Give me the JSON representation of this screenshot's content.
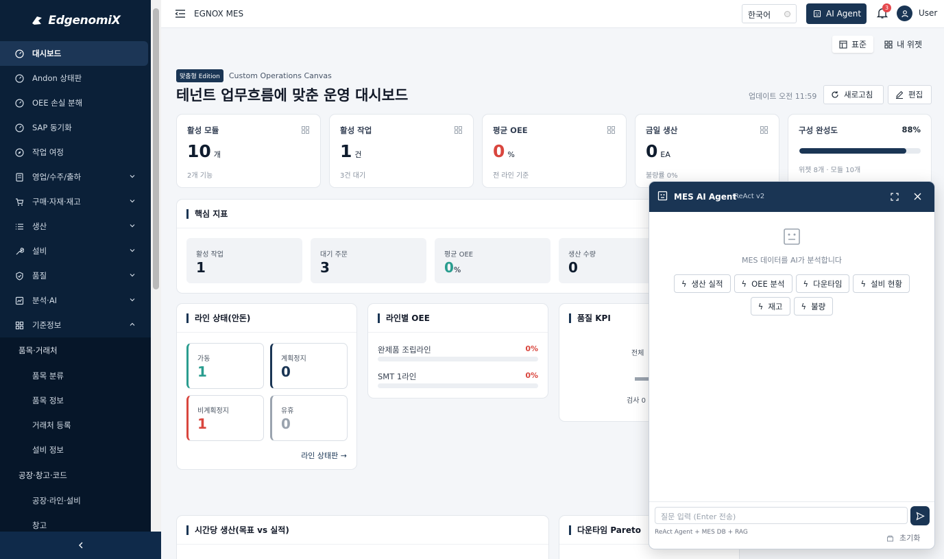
{
  "brand": {
    "name": "EdgenomiX"
  },
  "sidebar": {
    "items": [
      {
        "label": "대시보드",
        "icon": "gauge-icon",
        "active": true
      },
      {
        "label": "Andon 상태판",
        "icon": "gauge-icon"
      },
      {
        "label": "OEE 손실 분해",
        "icon": "gauge-icon"
      },
      {
        "label": "SAP 동기화",
        "icon": "gauge-icon"
      },
      {
        "label": "작업 여정",
        "icon": "compass-icon"
      },
      {
        "label": "영업/수주/출하",
        "icon": "calculator-icon"
      },
      {
        "label": "구매·자재·재고",
        "icon": "cart-icon"
      },
      {
        "label": "생산",
        "icon": "list-icon"
      },
      {
        "label": "설비",
        "icon": "wrench-icon"
      },
      {
        "label": "품질",
        "icon": "shield-check-icon"
      },
      {
        "label": "분석·AI",
        "icon": "chart-icon"
      },
      {
        "label": "기준정보",
        "icon": "grid-icon",
        "expanded": true
      }
    ],
    "submenu": {
      "group1": "품목·거래처",
      "group1_items": [
        "품목 분류",
        "품목 정보",
        "거래처 등록",
        "설비 정보"
      ],
      "group2": "공장·창고·코드",
      "group2_items": [
        "공장·라인·설비",
        "창고"
      ]
    }
  },
  "header": {
    "app_title": "EGNOX MES",
    "language": "한국어",
    "ai_button": "AI Agent",
    "notification_count": "3",
    "user": "User"
  },
  "view_toggle": {
    "standard": "표준",
    "my_widgets": "내 위젯"
  },
  "page": {
    "edition_tag": "맞춤형 Edition",
    "edition_sub": "Custom Operations Canvas",
    "title": "테넌트 업무흐름에 맞춘 운영 대시보드",
    "updated": "업데이트 오전 11:59",
    "refresh": "새로고침",
    "edit": "편집"
  },
  "stats": [
    {
      "label": "활성 모듈",
      "value": "10",
      "unit": "개",
      "note": "2개 기능"
    },
    {
      "label": "활성 작업",
      "value": "1",
      "unit": "건",
      "note": "3건 대기"
    },
    {
      "label": "평균 OEE",
      "value": "0",
      "unit": "%",
      "note": "전 라인 기준",
      "color": "#d9463e"
    },
    {
      "label": "금일 생산",
      "value": "0",
      "unit": "EA",
      "note": "불량률 0%"
    }
  ],
  "config": {
    "label": "구성 완성도",
    "percent": "88%",
    "progress": 0.88,
    "note": "위젯 8개 · 모듈 10개"
  },
  "core_kpi": {
    "title": "핵심 지표",
    "items": [
      {
        "label": "활성 작업",
        "value": "1",
        "unit": ""
      },
      {
        "label": "대기 주문",
        "value": "3",
        "unit": ""
      },
      {
        "label": "평균 OEE",
        "value": "0",
        "unit": "%",
        "color": "#2a9d8f"
      },
      {
        "label": "생산 수량",
        "value": "0",
        "unit": ""
      }
    ]
  },
  "line_status": {
    "title": "라인 상태(안돈)",
    "boxes": [
      {
        "label": "가동",
        "value": "1",
        "color": "#2a9d8f"
      },
      {
        "label": "계획정지",
        "value": "0",
        "color": "#1a3554"
      },
      {
        "label": "비계획정지",
        "value": "1",
        "color": "#d9463e"
      },
      {
        "label": "유휴",
        "value": "0",
        "color": "#9aa3ae"
      }
    ],
    "link": "라인 상태판 →"
  },
  "line_oee": {
    "title": "라인별 OEE",
    "rows": [
      {
        "name": "완제품 조립라인",
        "pct": "0%"
      },
      {
        "name": "SMT 1라인",
        "pct": "0%"
      }
    ]
  },
  "quality_kpi": {
    "title": "품질 KPI",
    "label_top": "전체",
    "label_bottom": "검사 0"
  },
  "hourly": {
    "title": "시간당 생산(목표 vs 실적)"
  },
  "downtime": {
    "title": "다운타임 Pareto"
  },
  "chat": {
    "title": "MES AI Agent",
    "version": "ReAct v2",
    "hint": "MES 데이터를 AI가 분석합니다",
    "chips": [
      "생산 실적",
      "OEE 분석",
      "다운타임",
      "설비 현황",
      "재고",
      "불량"
    ],
    "input_placeholder": "질문 입력 (Enter 전송)",
    "meta": "ReAct Agent + MES DB + RAG",
    "reset": "초기화"
  }
}
